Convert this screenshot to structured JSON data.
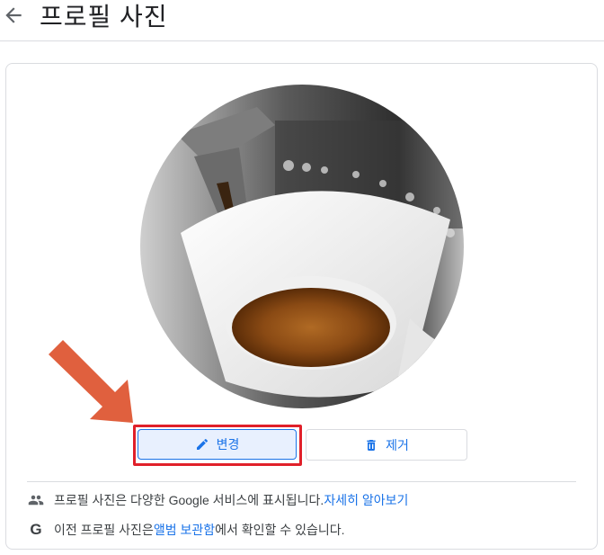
{
  "header": {
    "title": "프로필 사진",
    "back_icon": "arrow-back-icon"
  },
  "profile": {
    "image": "espresso-cup-photo"
  },
  "buttons": {
    "change_label": "변경",
    "change_icon": "pencil-icon",
    "remove_label": "제거",
    "remove_icon": "trash-icon"
  },
  "annotation": {
    "arrow_color": "#e0603e",
    "highlight_color": "#e0202a"
  },
  "info": {
    "row1": {
      "icon": "people-icon",
      "text": "프로필 사진은 다양한 Google 서비스에 표시됩니다. ",
      "link": "자세히 알아보기"
    },
    "row2": {
      "icon": "google-g-icon",
      "icon_text": "G",
      "prefix": "이전 프로필 사진은 ",
      "link": "앨범 보관함",
      "suffix": "에서 확인할 수 있습니다."
    }
  },
  "colors": {
    "accent": "#1a73e8",
    "accent_bg": "#e8f0fe",
    "border": "#dadce0"
  }
}
